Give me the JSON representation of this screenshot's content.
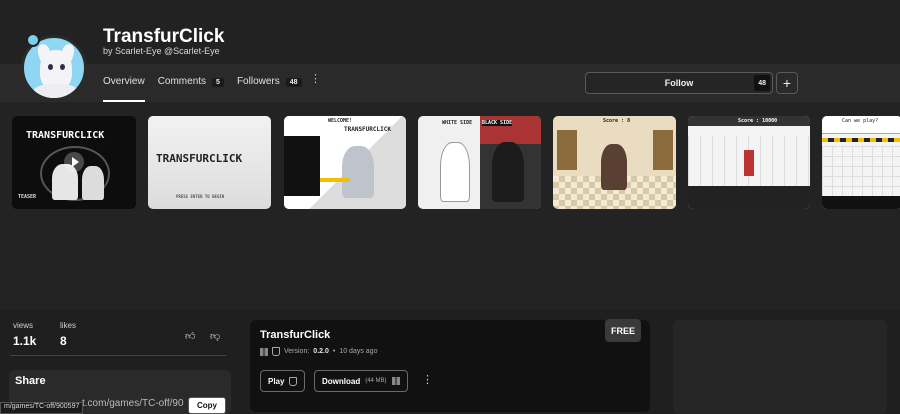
{
  "header": {
    "title": "TransfurClick",
    "byline": "by Scarlet-Eye @Scarlet-Eye"
  },
  "tabs": [
    {
      "label": "Overview",
      "count": ""
    },
    {
      "label": "Comments",
      "count": "5"
    },
    {
      "label": "Followers",
      "count": "48"
    }
  ],
  "follow": {
    "label": "Follow",
    "count": "48",
    "plus": "+"
  },
  "gallery": {
    "shot1": {
      "title": "TRANSFURCLICK",
      "sub": "TEASER"
    },
    "shot2": {
      "title": "TRANSFURCLICK",
      "sub": "PRESS ENTER TO BEGIN"
    },
    "shot3": {
      "title": "TRANSFURCLICK",
      "sub": "WELCOME!"
    },
    "shot4": {
      "left": "WHITE SIDE",
      "right": "BLACK SIDE"
    },
    "shot5": {
      "hud": "Score : 8"
    },
    "shot6": {
      "hud": "Score : 10000"
    },
    "shot7": {
      "hud": "Can we play?"
    }
  },
  "stats": {
    "views_label": "views",
    "views": "1.1k",
    "likes_label": "likes",
    "likes": "8"
  },
  "share": {
    "title": "Share",
    "url": "t.com/games/TC-off/90",
    "status_url": "m/games/TC-off/900597",
    "copy": "Copy"
  },
  "game": {
    "title": "TransfurClick",
    "version_label": "Version:",
    "version": "0.2.0",
    "updated": "10 days ago",
    "badge": "FREE",
    "play": "Play",
    "download": "Download",
    "download_size": "(44 MB)"
  },
  "icons": [
    "thumbs-up-icon",
    "thumbs-down-icon",
    "windows-icon",
    "html5-icon",
    "more-vert-icon",
    "plus-icon",
    "play-icon"
  ]
}
